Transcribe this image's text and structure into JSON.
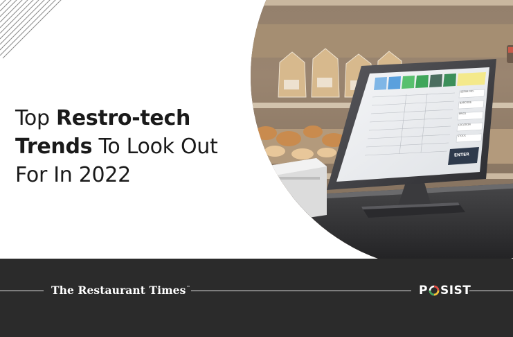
{
  "headline": {
    "line1_light": "Top ",
    "line1_bold": "Restro-tech",
    "line2_bold": "Trends",
    "line2_light": " To Look Out",
    "line3_light": "For In 2022"
  },
  "pos_screen": {
    "fields": [
      "SERIAL NO.",
      "BARCODE",
      "PRICE",
      "LOCATION",
      "STOCK"
    ],
    "enter_label": "ENTER",
    "tab_colors": [
      "#7fb6e6",
      "#5aa0dd",
      "#58c06e",
      "#3fa65a",
      "#4b6d5f",
      "#3c8f5a",
      "#f4e98b"
    ]
  },
  "footer": {
    "brand_left": "The Restaurant Times",
    "brand_left_mark": "™",
    "brand_right_prefix": "P",
    "brand_right_suffix": "SIST"
  },
  "colors": {
    "footer_bg": "#2b2b2b",
    "headline_text": "#1a1a1a",
    "footer_text": "#ffffff"
  }
}
